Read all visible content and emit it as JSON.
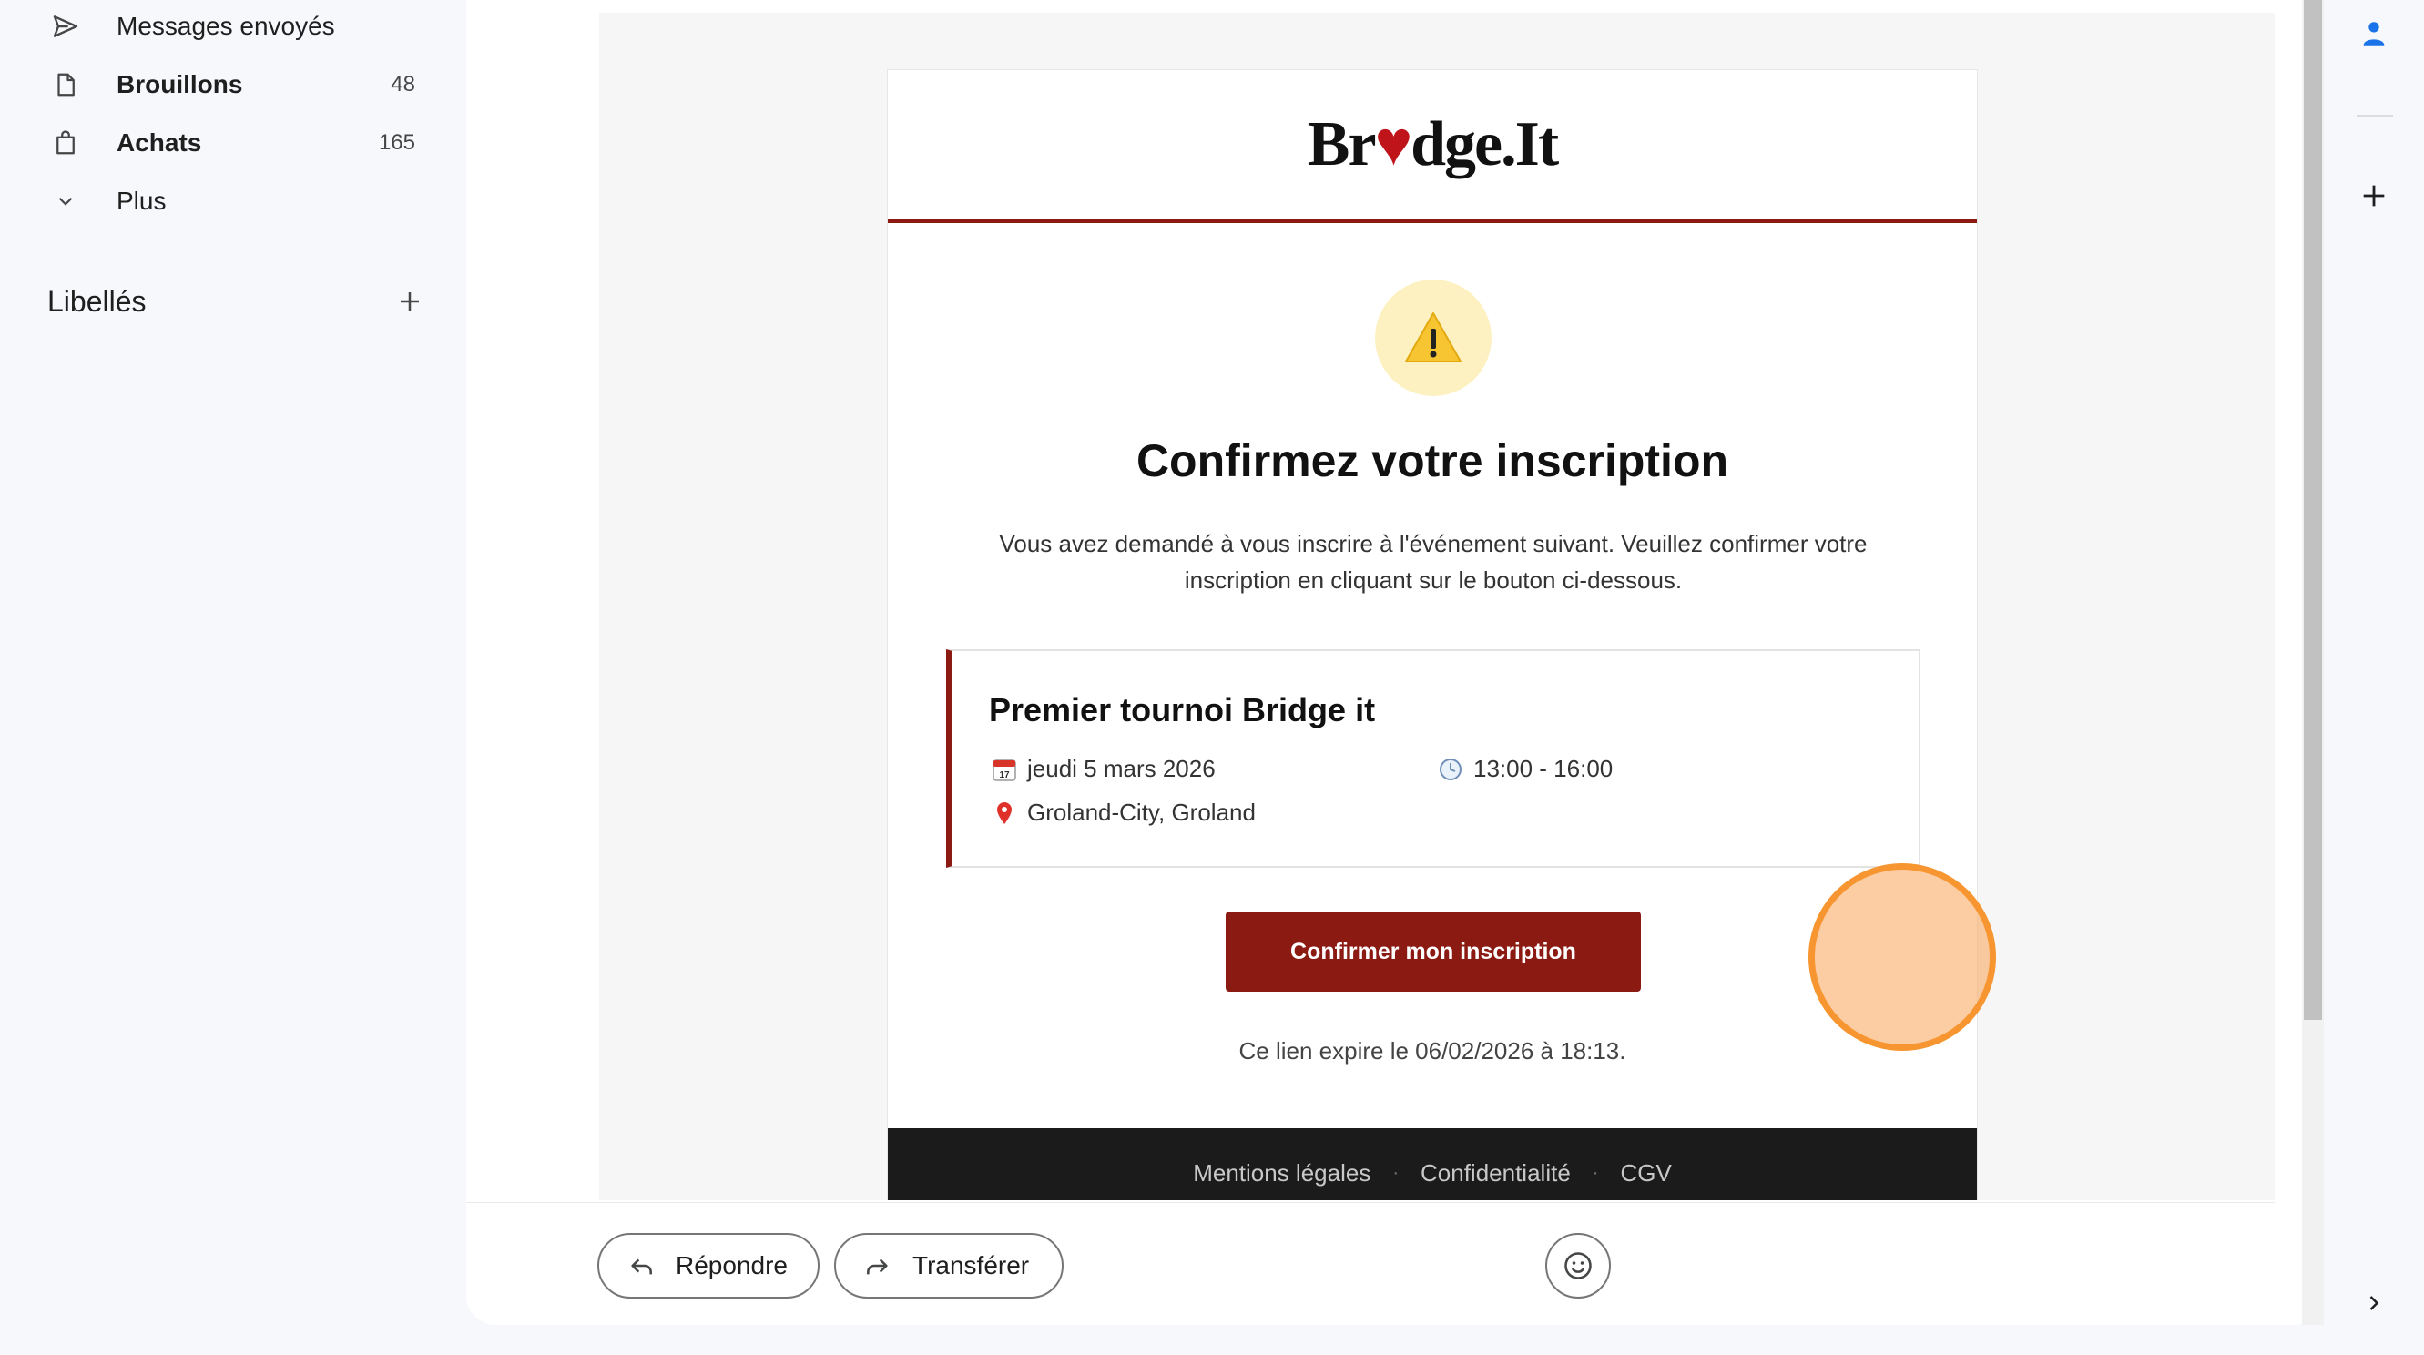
{
  "sidebar": {
    "items": [
      {
        "label": "Messages envoyés",
        "count": "",
        "icon": "send-icon",
        "bold": false
      },
      {
        "label": "Brouillons",
        "count": "48",
        "icon": "draft-icon",
        "bold": true
      },
      {
        "label": "Achats",
        "count": "165",
        "icon": "shopping-bag-icon",
        "bold": true
      },
      {
        "label": "Plus",
        "count": "",
        "icon": "chevron-down-icon",
        "bold": false
      }
    ],
    "labels_title": "Libellés"
  },
  "email": {
    "brand": "Bridge.It",
    "brand_parts": [
      "Br",
      "♥",
      "dge.It"
    ],
    "title": "Confirmez votre inscription",
    "intro": "Vous avez demandé à vous inscrire à l'événement suivant. Veuillez confirmer votre inscription en cliquant sur le bouton ci-dessous.",
    "event": {
      "title": "Premier tournoi Bridge it",
      "date": "jeudi 5 mars 2026",
      "time": "13:00 - 16:00",
      "location": "Groland-City, Groland"
    },
    "confirm_button": "Confirmer mon inscription",
    "expire": "Ce lien expire le 06/02/2026 à 18:13.",
    "footer_links": [
      "Mentions légales",
      "Confidentialité",
      "CGV"
    ]
  },
  "actions": {
    "reply": "Répondre",
    "forward": "Transférer"
  },
  "colors": {
    "brand_red": "#8b1a12",
    "warning_bg": "#fdf1c2",
    "footer_bg": "#1b1b1b"
  }
}
